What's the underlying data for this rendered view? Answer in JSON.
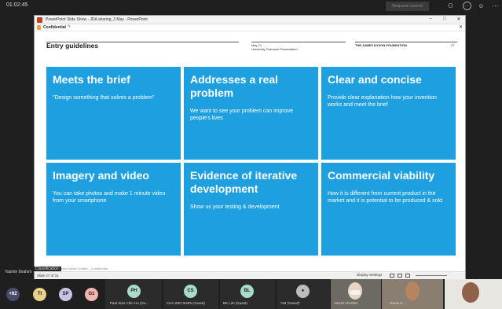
{
  "meeting": {
    "timer": "01:02:45",
    "request_control": "Request control",
    "presenter_name": "Yasmin Ibrahim",
    "classification": "Classification:"
  },
  "ppt": {
    "window_title": "PowerPoint Slide Show - JDA sharing_3 May - PowerPoint",
    "confidential_label": "Confidential",
    "status_left": "Slide 27 of 31",
    "display_settings": "Display Settings"
  },
  "slide": {
    "heading": "Entry guidelines",
    "date": "May 21",
    "subtitle": "University Outreach Presentation",
    "org": "THE JAMES DYSON FOUNDATION",
    "number": "27",
    "footer": "© 2021 James Dyson Limited – Confidential",
    "cards": [
      {
        "title": "Meets the brief",
        "text": "\"Design something that solves a problem\""
      },
      {
        "title": "Addresses a real problem",
        "text": "We want to see your problem can improve people's lives"
      },
      {
        "title": "Clear and concise",
        "text": "Provide clear explanation how your invention works and meet the brief"
      },
      {
        "title": "Imagery and video",
        "text": "You can take photos and make 1 minute video from your smartphone"
      },
      {
        "title": "Evidence of iterative development",
        "text": "Show us your  testing & development"
      },
      {
        "title": "Commercial viability",
        "text": "How it is different from current product in the market and it is potential to be produced & sold"
      }
    ]
  },
  "participants": {
    "overflow": "+62",
    "avatars": [
      {
        "initials": "TI",
        "color": "#e9d28a"
      },
      {
        "initials": "SP",
        "color": "#c9c2e6"
      },
      {
        "initials": "G1",
        "color": "#f2b6ae"
      }
    ],
    "tiles": [
      {
        "initials": "PH",
        "name": "Paul Sian Chin Ho (Gu...",
        "color": "#a8dbc9"
      },
      {
        "initials": "CS",
        "name": "CHA WEI SHEN (Guest)",
        "color": "#a8dbc9"
      },
      {
        "initials": "BL",
        "name": "BK Lim (Guest)",
        "color": "#a8dbc9"
      },
      {
        "initials": "",
        "name": "\"AM (Guest)\"",
        "color": "#bdbdbd"
      }
    ],
    "video_names": [
      "Yasmin Ibrahim",
      "Grace K..."
    ]
  },
  "colors": {
    "card_blue": "#1ea0e0",
    "teams_dark": "#1f1f1f"
  }
}
